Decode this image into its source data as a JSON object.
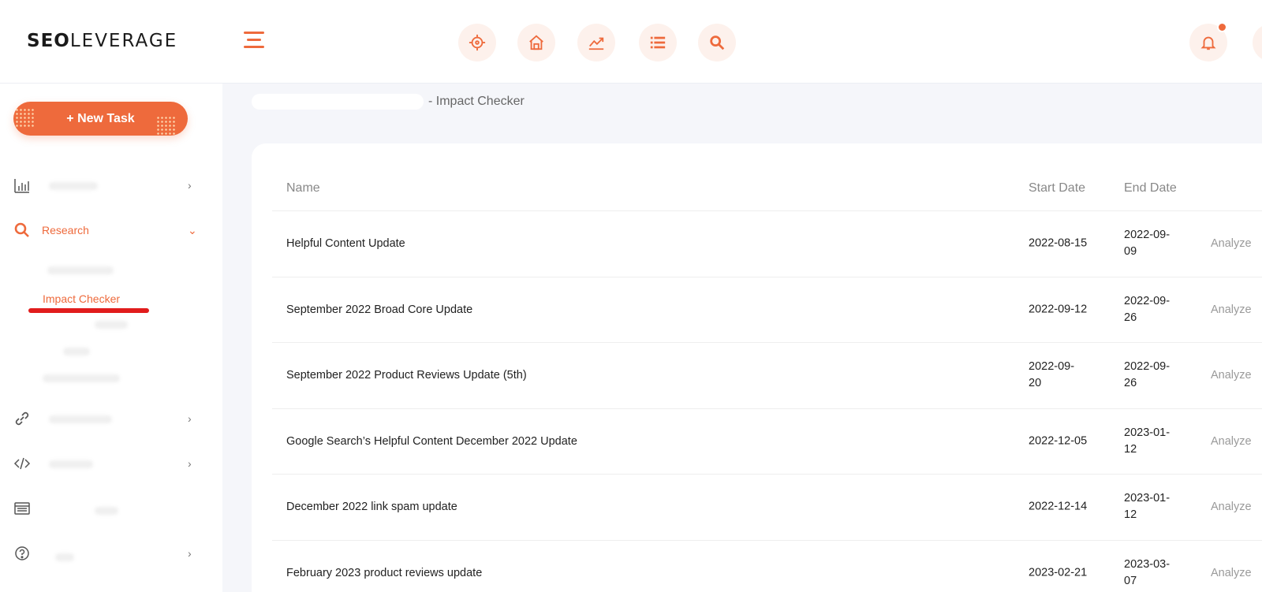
{
  "header": {
    "logo_bold": "SEO",
    "logo_light": "LEVERAGE",
    "icons": [
      "target-icon",
      "house-icon",
      "trend-chart-icon",
      "list-icon",
      "search-icon"
    ],
    "notification_icon": "bell-icon",
    "accent_color": "#ee6a3c"
  },
  "sidebar": {
    "new_task_label": "+ New Task",
    "items": [
      {
        "icon": "bar-chart-icon",
        "label": "",
        "expanded": false
      },
      {
        "icon": "search-icon",
        "label": "Research",
        "expanded": true
      },
      {
        "icon": "link-icon",
        "label": "",
        "expanded": false
      },
      {
        "icon": "code-icon",
        "label": "",
        "expanded": false
      },
      {
        "icon": "browser-icon",
        "label": "",
        "expanded": false
      },
      {
        "icon": "help-circle-icon",
        "label": "",
        "expanded": false
      }
    ],
    "research_sub": {
      "active": "Impact Checker"
    }
  },
  "breadcrumb": {
    "current": "- Impact Checker"
  },
  "table": {
    "columns": [
      "Name",
      "Start Date",
      "End Date"
    ],
    "action_label": "Analyze",
    "rows": [
      {
        "name": "Helpful Content Update",
        "start": "2022-08-15",
        "end": "2022-09-\n09"
      },
      {
        "name": "September 2022 Broad Core Update",
        "start": "2022-09-12",
        "end": "2022-09-\n26"
      },
      {
        "name": "September 2022 Product Reviews Update (5th)",
        "start": "2022-09-\n20",
        "end": "2022-09-\n26"
      },
      {
        "name": "Google Search’s Helpful Content December 2022 Update",
        "start": "2022-12-05",
        "end": "2023-01-\n12"
      },
      {
        "name": "December 2022 link spam update",
        "start": "2022-12-14",
        "end": "2023-01-\n12"
      },
      {
        "name": "February 2023 product reviews update",
        "start": "2023-02-21",
        "end": "2023-03-\n07"
      }
    ]
  }
}
